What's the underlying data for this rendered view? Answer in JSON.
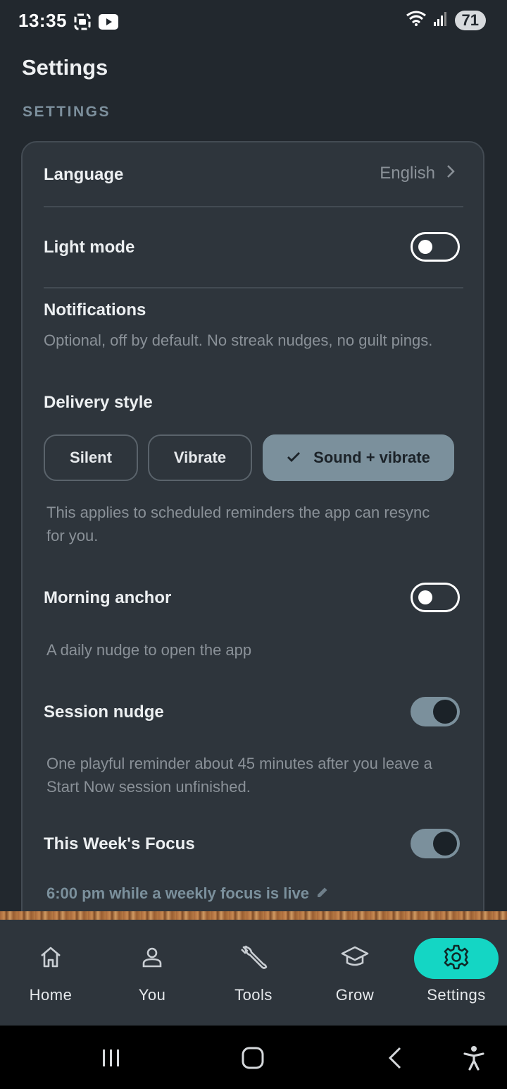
{
  "status_bar": {
    "time": "13:35",
    "battery": "71"
  },
  "header": {
    "title": "Settings",
    "section_label": "SETTINGS"
  },
  "settings": {
    "language": {
      "label": "Language",
      "value": "English"
    },
    "light_mode": {
      "label": "Light mode",
      "enabled": false
    },
    "notifications": {
      "label": "Notifications",
      "description": "Optional, off by default. No streak nudges, no guilt pings.",
      "delivery_style_label": "Delivery style",
      "options": [
        "Silent",
        "Vibrate",
        "Sound + vibrate"
      ],
      "selected": "Sound + vibrate",
      "delivery_note": "This applies to scheduled reminders the app can resync for you."
    },
    "morning_anchor": {
      "label": "Morning anchor",
      "enabled": false,
      "description": "A daily nudge to open the app"
    },
    "session_nudge": {
      "label": "Session nudge",
      "enabled": true,
      "description": "One playful reminder about 45 minutes after you leave a Start Now session unfinished."
    },
    "weekly_focus": {
      "label": "This Week's Focus",
      "enabled": true,
      "schedule": "6:00 pm while a weekly focus is live"
    }
  },
  "bottom_nav": {
    "items": [
      {
        "label": "Home",
        "icon": "home-icon"
      },
      {
        "label": "You",
        "icon": "person-icon"
      },
      {
        "label": "Tools",
        "icon": "wrench-icon"
      },
      {
        "label": "Grow",
        "icon": "graduation-cap-icon"
      },
      {
        "label": "Settings",
        "icon": "gear-icon"
      }
    ],
    "active": "Settings",
    "active_color": "#14d6c4"
  },
  "colors": {
    "background": "#22282e",
    "card": "#2e353c",
    "accent": "#7b909c"
  }
}
